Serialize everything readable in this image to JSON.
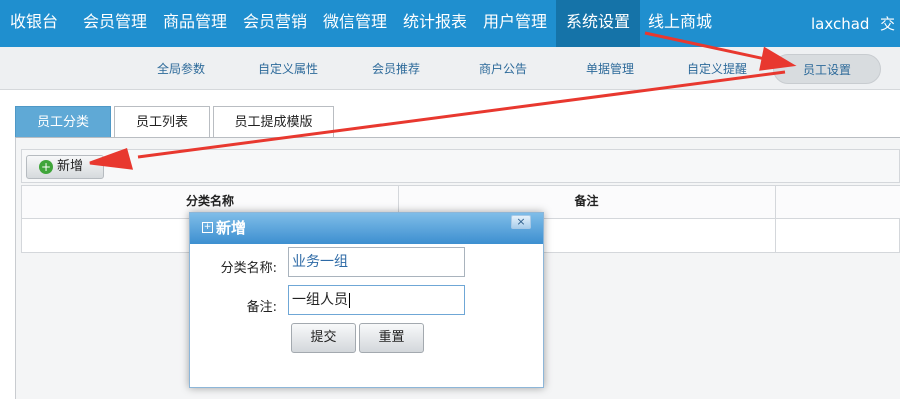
{
  "topnav": {
    "items": [
      {
        "label": "收银台"
      },
      {
        "label": "会员管理"
      },
      {
        "label": "商品管理"
      },
      {
        "label": "会员营销"
      },
      {
        "label": "微信管理"
      },
      {
        "label": "统计报表"
      },
      {
        "label": "用户管理"
      },
      {
        "label": "系统设置",
        "active": true
      },
      {
        "label": "线上商城"
      }
    ],
    "username": "laxchad",
    "exchange": "交"
  },
  "subnav": {
    "items": [
      {
        "label": "全局参数"
      },
      {
        "label": "自定义属性"
      },
      {
        "label": "会员推荐"
      },
      {
        "label": "商户公告"
      },
      {
        "label": "单据管理"
      },
      {
        "label": "自定义提醒"
      },
      {
        "label": "员工设置",
        "active": true
      }
    ]
  },
  "tabs": [
    {
      "label": "员工分类",
      "active": true
    },
    {
      "label": "员工列表"
    },
    {
      "label": "员工提成模版"
    }
  ],
  "toolbar": {
    "add_label": "新增",
    "add_icon": "plus-circle-icon"
  },
  "grid": {
    "columns": [
      "分类名称",
      "备注"
    ]
  },
  "dialog": {
    "title": "新增",
    "close": "×",
    "fields": {
      "category_label": "分类名称:",
      "category_value": "业务一组",
      "note_label": "备注:",
      "note_value": "一组人员"
    },
    "submit_label": "提交",
    "reset_label": "重置"
  },
  "colors": {
    "nav_bg": "#1f8fcf",
    "nav_active": "#1573a8",
    "arrow": "#e8382f",
    "tab_active": "#5fa9d6"
  }
}
